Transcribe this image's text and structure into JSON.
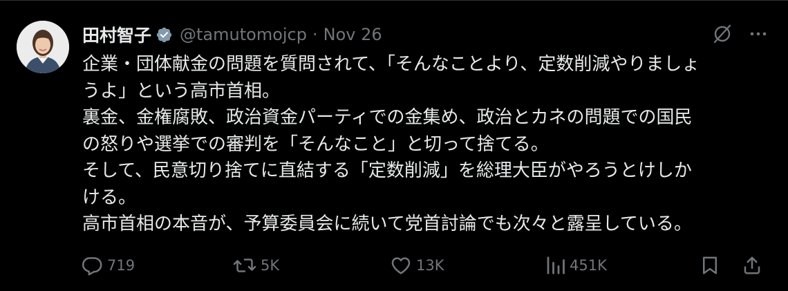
{
  "author": {
    "display_name": "田村智子",
    "handle": "@tamutomojcp",
    "separator": "·",
    "date": "Nov 26",
    "verified_color": "#829aab",
    "avatar_icon": "profile-photo"
  },
  "body_lines": [
    "企業・団体献金の問題を質問されて、「そんなことより、定数削減やりましょ",
    "うよ」という高市首相。",
    "裏金、金権腐敗、政治資金パーティでの金集め、政治とカネの問題での国民",
    "の怒りや選挙での審判を「そんなこと」と切って捨てる。",
    "そして、民意切り捨てに直結する「定数削減」を総理大臣がやろうとけしか",
    "ける。",
    "高市首相の本音が、予算委員会に続いて党首討論でも次々と露呈している。"
  ],
  "top_icons": [
    "grok-icon",
    "more-icon"
  ],
  "stats": {
    "replies": "719",
    "reposts": "5K",
    "likes": "13K",
    "views": "451K"
  },
  "colors": {
    "background": "#000000",
    "text": "#e7e9ea",
    "secondary": "#71767b"
  }
}
